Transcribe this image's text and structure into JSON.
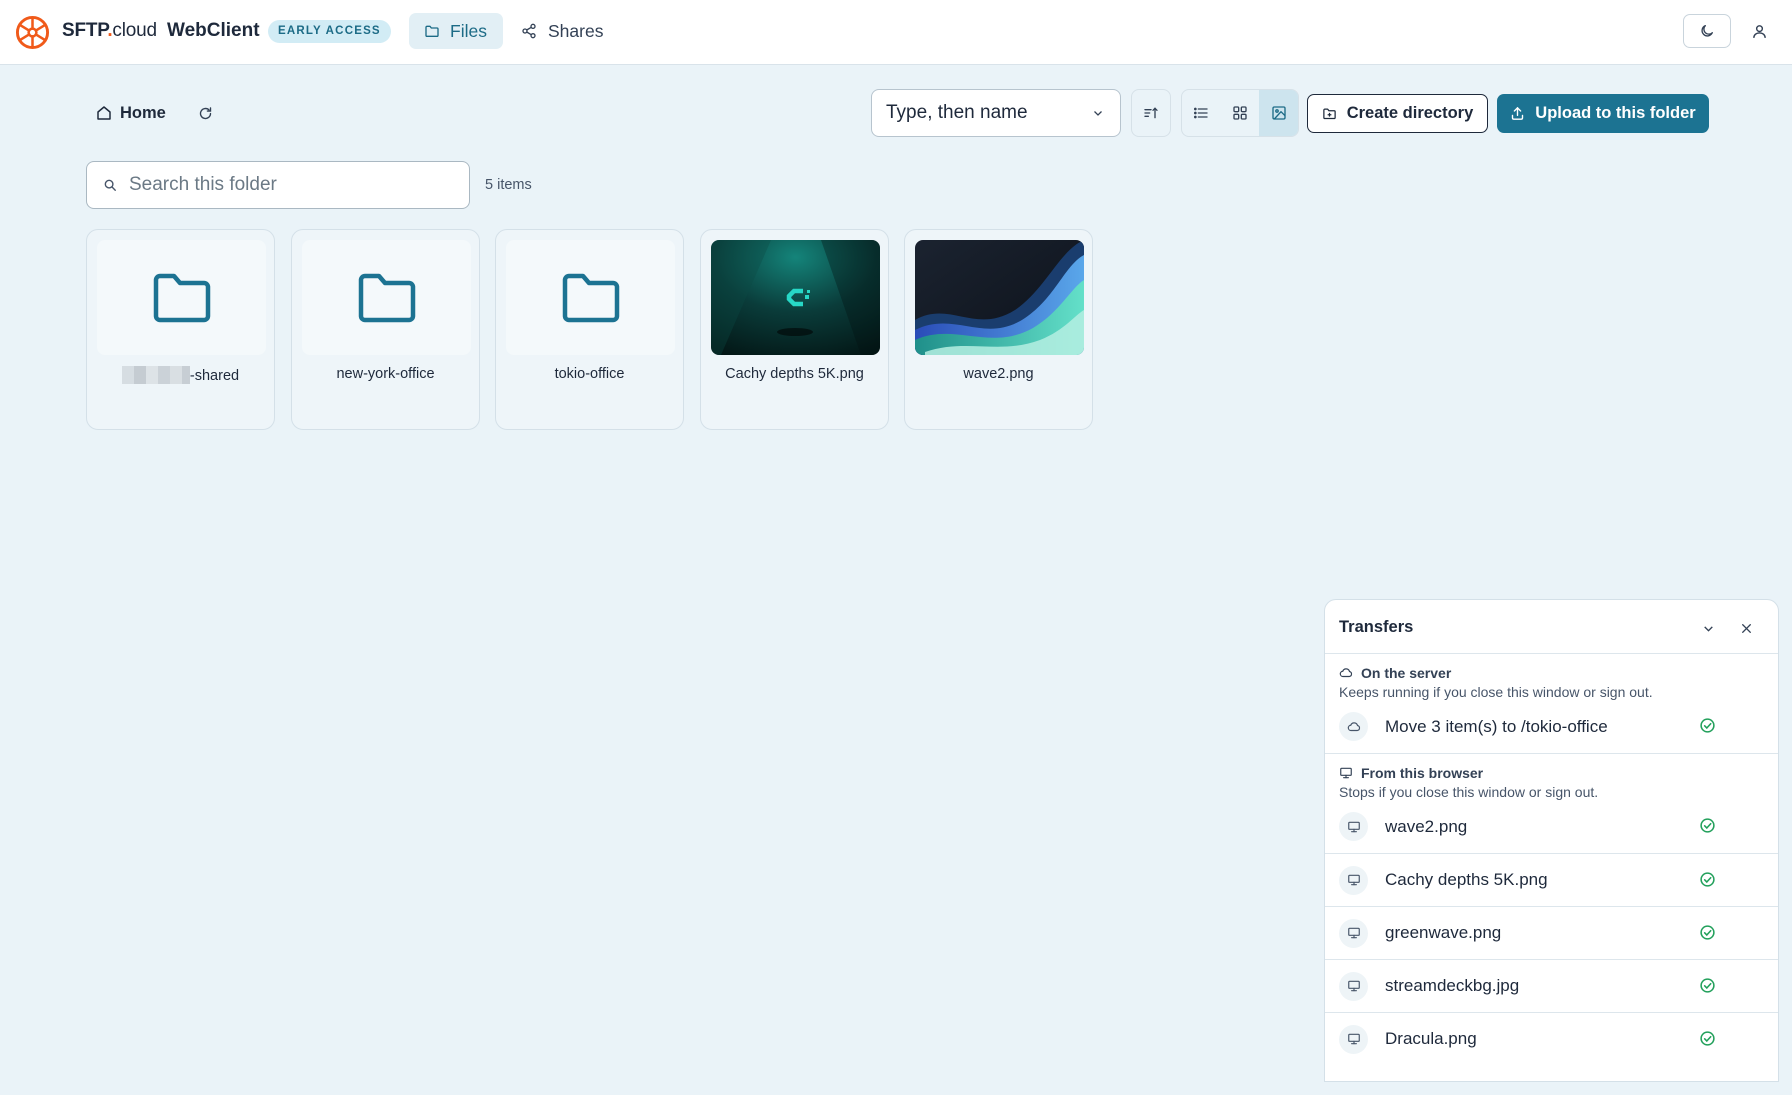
{
  "header": {
    "brand_main": "SFTP",
    "brand_dot": ".",
    "brand_suffix": "cloud",
    "app_name": "WebClient",
    "badge": "EARLY ACCESS",
    "nav": {
      "files": "Files",
      "shares": "Shares"
    },
    "accent_color": "#f05a1a"
  },
  "toolbar": {
    "home_label": "Home",
    "sort_value": "Type, then name",
    "create_label": "Create directory",
    "upload_label": "Upload to this folder",
    "active_view": "gallery",
    "primary_color": "#1c7392"
  },
  "search": {
    "placeholder": "Search this folder",
    "value": "",
    "count": "5 items"
  },
  "files": [
    {
      "name": "-shared",
      "kind": "folder",
      "redacted_prefix": true
    },
    {
      "name": "new-york-office",
      "kind": "folder"
    },
    {
      "name": "tokio-office",
      "kind": "folder"
    },
    {
      "name": "Cachy depths 5K.png",
      "kind": "image"
    },
    {
      "name": "wave2.png",
      "kind": "image"
    }
  ],
  "transfers": {
    "title": "Transfers",
    "server": {
      "heading": "On the server",
      "description": "Keeps running if you close this window or sign out.",
      "items": [
        {
          "label": "Move 3 item(s) to /tokio-office",
          "status": "done"
        }
      ]
    },
    "browser": {
      "heading": "From this browser",
      "description": "Stops if you close this window or sign out.",
      "items": [
        {
          "label": "wave2.png",
          "status": "done"
        },
        {
          "label": "Cachy depths 5K.png",
          "status": "done"
        },
        {
          "label": "greenwave.png",
          "status": "done"
        },
        {
          "label": "streamdeckbg.jpg",
          "status": "done"
        },
        {
          "label": "Dracula.png",
          "status": "done"
        }
      ]
    },
    "success_color": "#22a05b"
  }
}
